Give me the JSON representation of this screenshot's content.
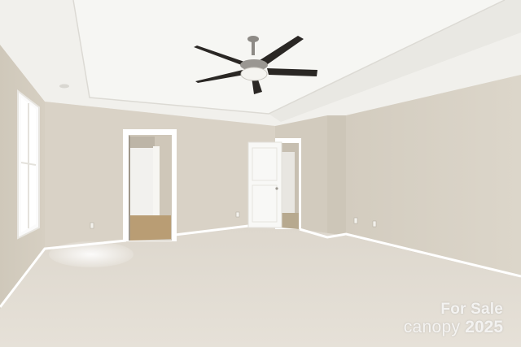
{
  "photo": {
    "subject": "empty-bedroom-interior",
    "colors": {
      "wall": "#d8d1c4",
      "wall_shadow": "#c9c1b3",
      "ceiling": "#f3f2ee",
      "carpet": "#e4ded4",
      "trim": "#ffffff",
      "fan_blade": "#2a2724",
      "fan_metal": "#8d8a85"
    }
  },
  "watermark": {
    "line1": "For Sale",
    "brand": "canopy",
    "year": "2025"
  }
}
